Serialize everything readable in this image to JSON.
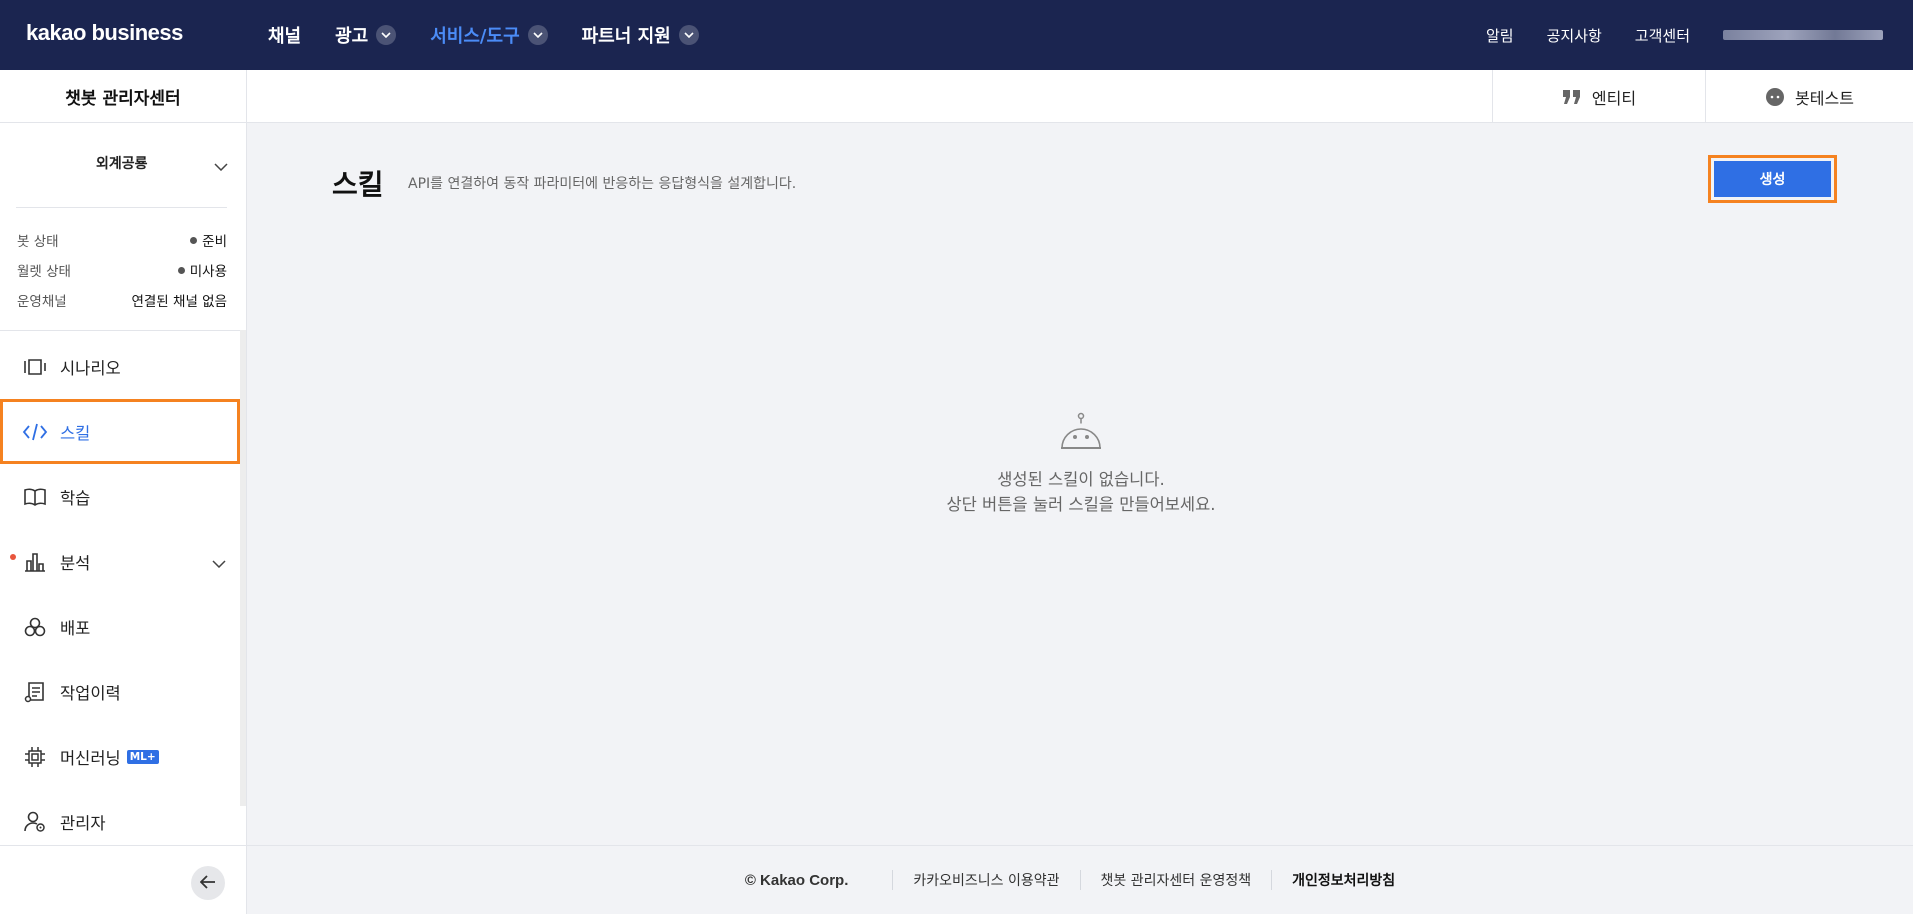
{
  "brand": {
    "logo": "kakao business"
  },
  "topnav": {
    "items": [
      {
        "label": "채널",
        "has_dropdown": false
      },
      {
        "label": "광고",
        "has_dropdown": true
      },
      {
        "label": "서비스/도구",
        "has_dropdown": true,
        "active": true
      },
      {
        "label": "파트너 지원",
        "has_dropdown": true
      }
    ],
    "right": [
      "알림",
      "공지사항",
      "고객센터"
    ]
  },
  "sidebar": {
    "title": "챗봇 관리자센터",
    "bot_name": "외계공룡",
    "info": [
      {
        "key": "봇 상태",
        "value": "준비",
        "dot": true
      },
      {
        "key": "월렛 상태",
        "value": "미사용",
        "dot": true
      },
      {
        "key": "운영채널",
        "value": "연결된 채널 없음",
        "dot": false
      }
    ],
    "menu": [
      {
        "label": "시나리오",
        "icon": "scenario-icon"
      },
      {
        "label": "스킬",
        "icon": "code-icon",
        "active": true
      },
      {
        "label": "학습",
        "icon": "book-icon"
      },
      {
        "label": "분석",
        "icon": "chart-icon",
        "expandable": true,
        "new_dot": true
      },
      {
        "label": "배포",
        "icon": "deploy-icon"
      },
      {
        "label": "작업이력",
        "icon": "history-icon"
      },
      {
        "label": "머신러닝",
        "icon": "chip-icon",
        "badge": "ML+"
      },
      {
        "label": "관리자",
        "icon": "admin-icon"
      }
    ]
  },
  "subheader": {
    "tabs": [
      {
        "label": "엔티티",
        "icon": "quote-icon"
      },
      {
        "label": "봇테스트",
        "icon": "chat-icon"
      }
    ]
  },
  "main": {
    "title": "스킬",
    "description": "API를 연결하여 동작 파라미터에 반응하는 응답형식을 설계합니다.",
    "create_label": "생성",
    "empty_line1": "생성된 스킬이 없습니다.",
    "empty_line2": "상단 버튼을 눌러 스킬을 만들어보세요."
  },
  "footer": {
    "copyright": "© Kakao Corp.",
    "links": [
      "카카오비즈니스 이용약관",
      "챗봇 관리자센터 운영정책",
      "개인정보처리방침"
    ]
  },
  "colors": {
    "nav_bg": "#1b2550",
    "accent": "#2f6fe4",
    "highlight": "#f58220",
    "active_nav": "#4b8cf7"
  }
}
